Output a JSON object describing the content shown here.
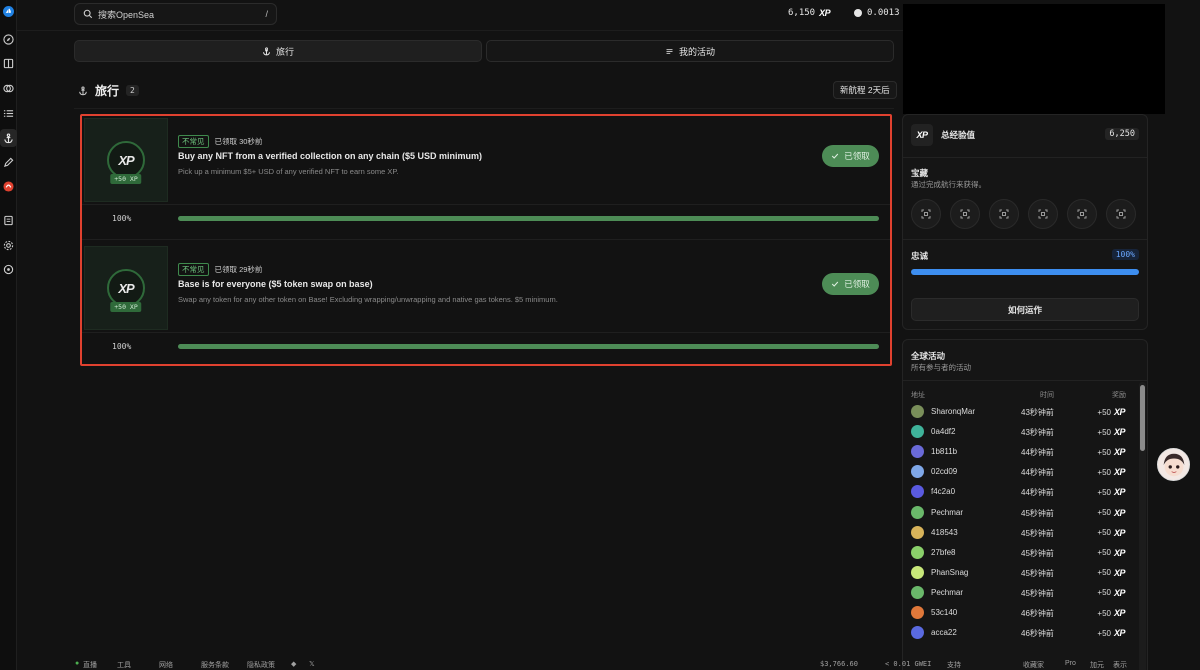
{
  "header": {
    "search_placeholder": "搜索OpenSea",
    "search_shortcut": "/",
    "xp_count": "6,150",
    "xp_label": "XP",
    "balance": "0.0013"
  },
  "tabs": [
    {
      "label": "旅行"
    },
    {
      "label": "我的活动"
    }
  ],
  "journey": {
    "title": "旅行",
    "count": "2",
    "new_voyage": "新航程 2天后"
  },
  "quests": [
    {
      "rarity": "不常见",
      "claimed_time": "已领取 30秒前",
      "title": "Buy any NFT from a verified collection on any chain ($5 USD minimum)",
      "description": "Pick up a minimum $5+ USD of any verified NFT to earn some XP.",
      "reward_badge": "XP",
      "reward_pill": "+50 XP",
      "button_label": "已领取",
      "progress_text": "100%",
      "progress": 1.0
    },
    {
      "rarity": "不常见",
      "claimed_time": "已领取 29秒前",
      "title": "Base is for everyone ($5 token swap on base)",
      "description": "Swap any token for any other token on Base! Excluding wrapping/unwrapping and native gas tokens. $5 minimum.",
      "reward_badge": "XP",
      "reward_pill": "+50 XP",
      "button_label": "已领取",
      "progress_text": "100%",
      "progress": 1.0
    }
  ],
  "sidebar_panel": {
    "total_xp_label": "总经验值",
    "total_xp_value": "6,250",
    "treasure_title": "宝藏",
    "treasure_sub": "通过完成航行来获得。",
    "loyalty_title": "忠诚",
    "loyalty_value": "100%",
    "loyalty_progress": 1.0,
    "how_button": "如何运作"
  },
  "global_activity": {
    "title": "全球活动",
    "subtitle": "所有参与者的活动",
    "col_address": "地址",
    "col_time": "时间",
    "col_reward": "奖励",
    "rows": [
      {
        "address": "SharonqMar",
        "time": "43秒钟前",
        "reward": "+50",
        "color": "#7a8f5a"
      },
      {
        "address": "0a4df2",
        "time": "43秒钟前",
        "reward": "+50",
        "color": "#3fb39a"
      },
      {
        "address": "1b811b",
        "time": "44秒钟前",
        "reward": "+50",
        "color": "#6a6ad8"
      },
      {
        "address": "02cd09",
        "time": "44秒钟前",
        "reward": "+50",
        "color": "#7fa7e8"
      },
      {
        "address": "f4c2a0",
        "time": "44秒钟前",
        "reward": "+50",
        "color": "#5a5ae0"
      },
      {
        "address": "Pechmar",
        "time": "45秒钟前",
        "reward": "+50",
        "color": "#6ab86a"
      },
      {
        "address": "418543",
        "time": "45秒钟前",
        "reward": "+50",
        "color": "#d8b35a"
      },
      {
        "address": "27bfe8",
        "time": "45秒钟前",
        "reward": "+50",
        "color": "#8ad06a"
      },
      {
        "address": "PhanSnag",
        "time": "45秒钟前",
        "reward": "+50",
        "color": "#c8e87a"
      },
      {
        "address": "Pechmar",
        "time": "45秒钟前",
        "reward": "+50",
        "color": "#6ab86a"
      },
      {
        "address": "53c140",
        "time": "46秒钟前",
        "reward": "+50",
        "color": "#e0783a"
      },
      {
        "address": "acca22",
        "time": "46秒钟前",
        "reward": "+50",
        "color": "#5a6ae0"
      }
    ]
  },
  "footer": {
    "live": "直播",
    "tools": "工具",
    "network": "网络",
    "terms": "服务条款",
    "privacy": "隐私政策",
    "price": "$3,766.60",
    "gas": "< 0.01 GWEI",
    "support": "支持",
    "collector": "收藏家",
    "pro": "Pro",
    "currency": "加元",
    "lang": "表示"
  }
}
